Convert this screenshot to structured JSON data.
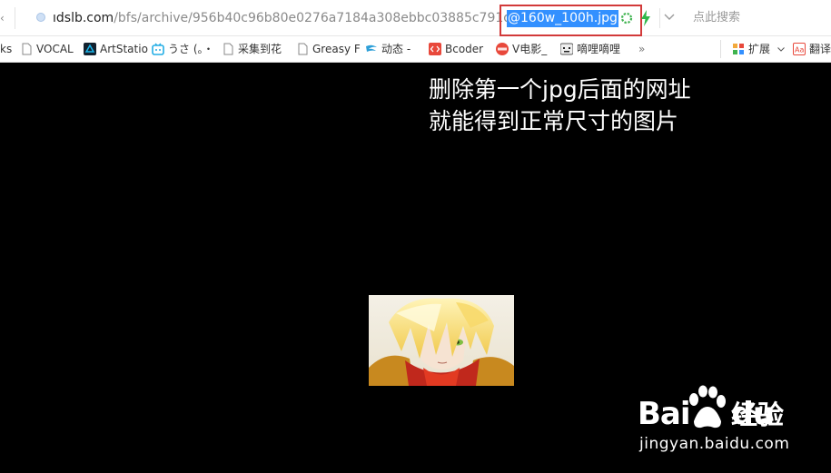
{
  "address_bar": {
    "url_host": "ıdslb.com",
    "url_path": "/bfs/archive/956b40c96b80e0276a7184a308ebbc03885c791d.jpg",
    "url_selected": "@160w_100h.jpg",
    "search_placeholder": "点此搜索",
    "highlight_color": "#d23a3a",
    "selection_color": "#3390ff"
  },
  "bookmarks": {
    "items": [
      {
        "label": "ks",
        "icon": "none"
      },
      {
        "label": "VOCAL",
        "icon": "page-icon"
      },
      {
        "label": "ArtStatio",
        "icon": "artstation-icon"
      },
      {
        "label": "うさ (。・",
        "icon": "bilibili-icon"
      },
      {
        "label": "采集到花",
        "icon": "page-icon"
      },
      {
        "label": "Greasy F",
        "icon": "page-icon"
      },
      {
        "label": "动态 -",
        "icon": "wing-icon"
      },
      {
        "label": "Bcoder",
        "icon": "code-icon"
      },
      {
        "label": "V电影_",
        "icon": "new-badge-icon"
      },
      {
        "label": "嘀哩嘀哩",
        "icon": "face-icon"
      }
    ],
    "overflow": "»",
    "extensions_label": "扩展",
    "translate_label": "翻译"
  },
  "content": {
    "annotation_line1": "删除第一个jpg后面的网址",
    "annotation_line2": "就能得到正常尺寸的图片"
  },
  "watermark": {
    "brand_latin_1": "Bai",
    "brand_latin_2": "du",
    "brand_cn": "经验",
    "url": "jingyan.baidu.com"
  }
}
